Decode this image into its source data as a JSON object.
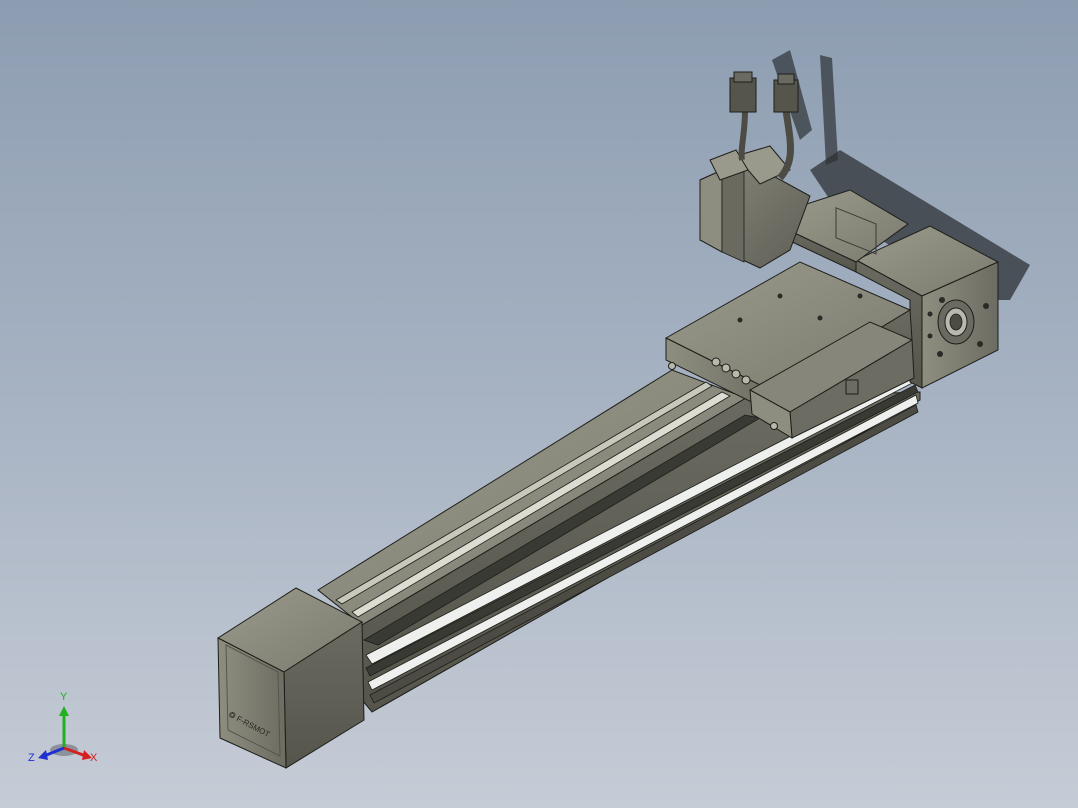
{
  "viewport": {
    "background_top": "#8d9db1",
    "background_bottom": "#c6ccd6"
  },
  "model": {
    "body_color": "#77776b",
    "body_light": "#a5a597",
    "body_dark": "#4c4c44",
    "edge_color": "#1e1e1a",
    "rail_highlight": "#eef0ee",
    "brand_mark": "❂ F-RSMOT"
  },
  "triad": {
    "x_label": "X",
    "y_label": "Y",
    "z_label": "Z",
    "x_color": "#d42020",
    "y_color": "#20b020",
    "z_color": "#2030d0"
  }
}
